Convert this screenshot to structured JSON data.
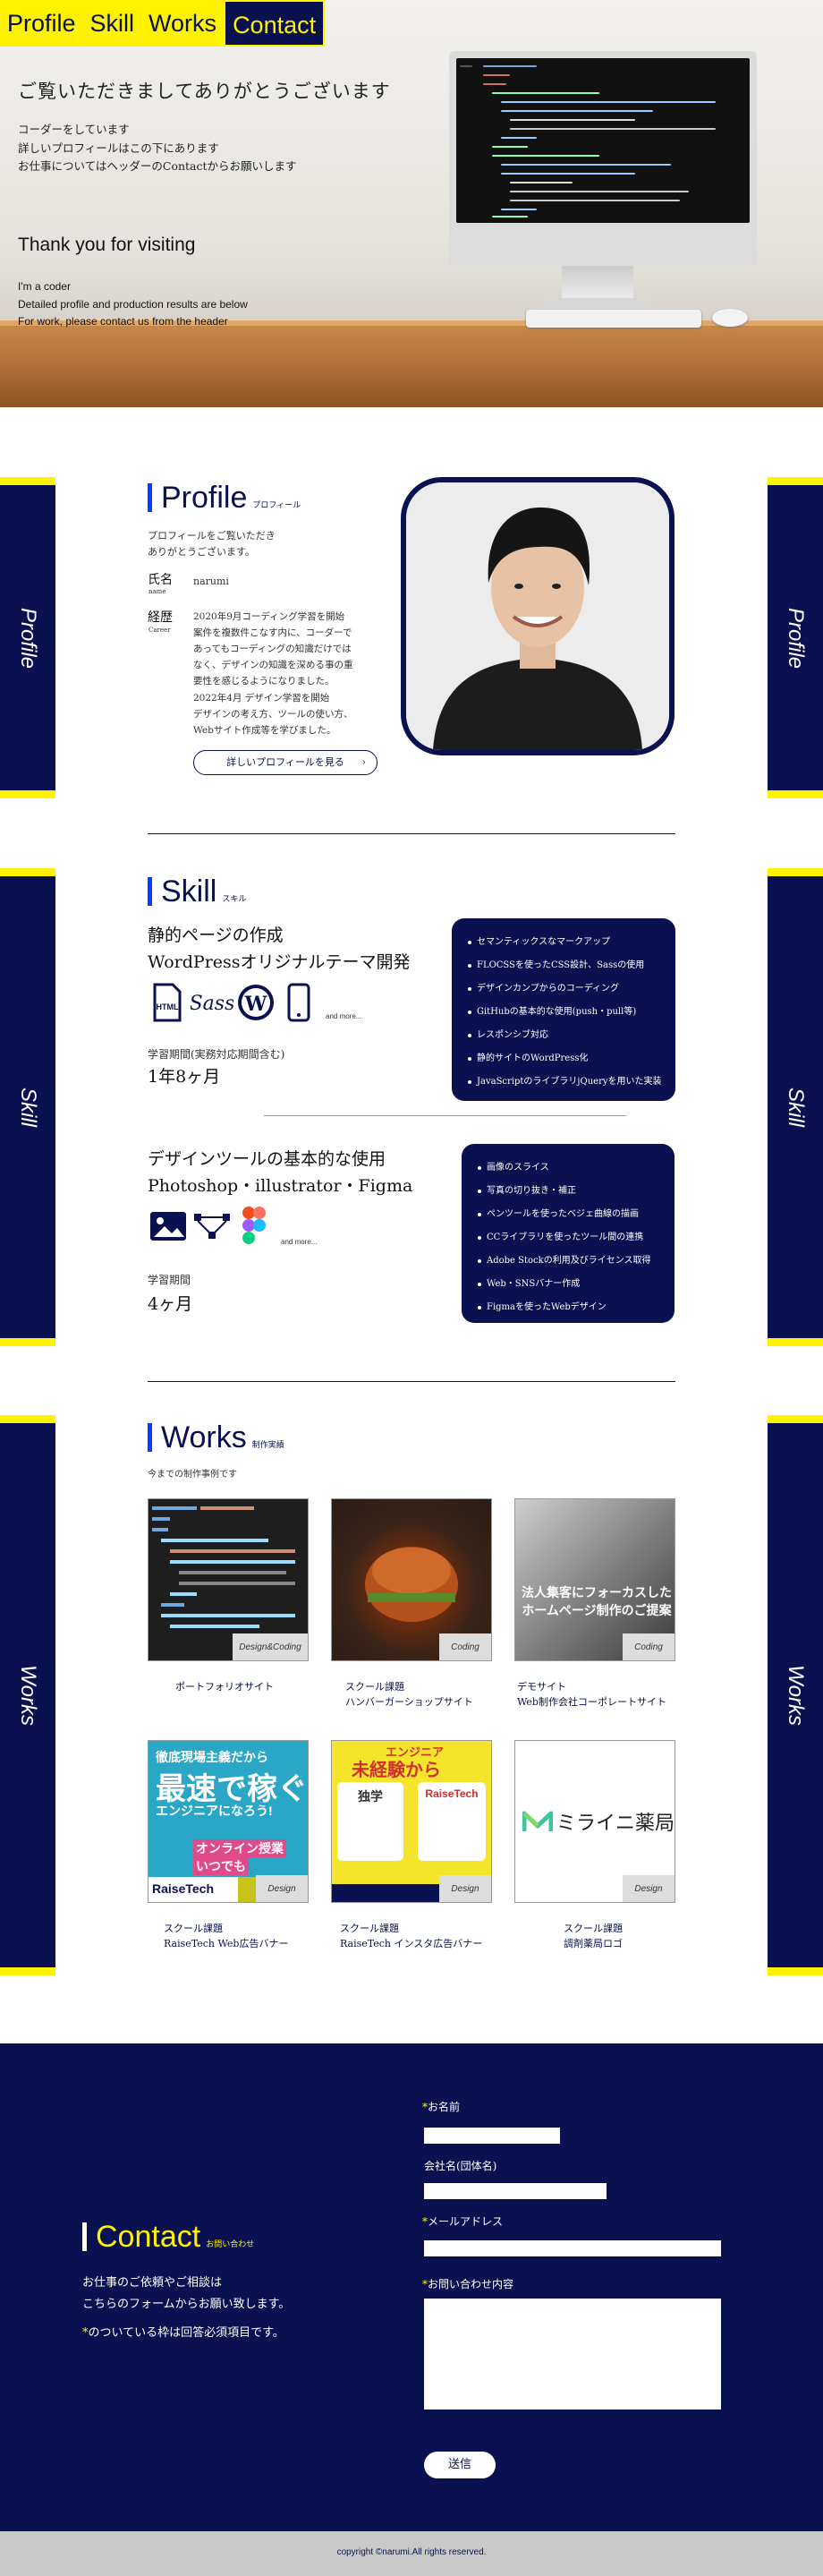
{
  "nav": {
    "items": [
      "Profile",
      "Skill",
      "Works",
      "Contact"
    ]
  },
  "hero": {
    "title_jp": "ご覧いただきましてありがとうございます",
    "lines_jp": [
      "コーダーをしています",
      "詳しいプロフィールはこの下にあります",
      "お仕事についてはヘッダーのContactからお願いします"
    ],
    "title_en": "Thank you for visiting",
    "lines_en": [
      "I'm a coder",
      "Detailed profile and production results are below",
      "For work, please contact us from the header"
    ]
  },
  "tabs": {
    "profile": "Profile",
    "skill": "Skill",
    "works": "Works"
  },
  "profile": {
    "title": "Profile",
    "sub": "プロフィール",
    "intro": [
      "プロフィールをご覧いただき",
      "ありがとうございます。"
    ],
    "name_label": "氏名",
    "name_sub": "name",
    "name": "narumi",
    "career_label": "経歴",
    "career_sub": "Career",
    "career1": [
      "2020年9月コーディング学習を開始",
      "案件を複数件こなす内に、コーダーで",
      "あってもコーディングの知識だけでは",
      "なく、デザインの知識を深める事の重",
      "要性を感じるようになりました。"
    ],
    "career2": [
      "2022年4月 デザイン学習を開始",
      "デザインの考え方、ツールの使い方、",
      "Webサイト作成等を学びました。"
    ],
    "button": "詳しいプロフィールを見る"
  },
  "skill": {
    "title": "Skill",
    "sub": "スキル",
    "block1": {
      "heading": [
        "静的ページの作成",
        "WordPressオリジナルテーマ開発"
      ],
      "more": "and more...",
      "period_label": "学習期間(実務対応期間含む)",
      "period": "1年8ヶ月",
      "items": [
        "セマンティックスなマークアップ",
        "FLOCSSを使ったCSS設計、Sassの使用",
        "デザインカンプからのコーディング",
        "GitHubの基本的な使用(push・pull等)",
        "レスポンシブ対応",
        "静的サイトのWordPress化",
        "JavaScriptのライブラリjQueryを用いた実装"
      ]
    },
    "block2": {
      "heading": [
        "デザインツールの基本的な使用",
        "Photoshop・illustrator・Figma"
      ],
      "more": "and more...",
      "period_label": "学習期間",
      "period": "4ヶ月",
      "items": [
        "画像のスライス",
        "写真の切り抜き・補正",
        "ペンツールを使ったベジェ曲線の描画",
        "CCライブラリを使ったツール間の連携",
        "Adobe Stockの利用及びライセンス取得",
        "Web・SNSバナー作成",
        "Figmaを使ったWebデザイン"
      ]
    }
  },
  "works": {
    "title": "Works",
    "sub": "制作実績",
    "intro": "今までの制作事例です",
    "items": [
      {
        "tag": "Design&Coding",
        "caption": [
          "ポートフォリオサイト"
        ]
      },
      {
        "tag": "Coding",
        "caption": [
          "スクール課題",
          "ハンバーガーショップサイト"
        ]
      },
      {
        "tag": "Coding",
        "caption": [
          "デモサイト",
          "Web制作会社コーポレートサイト"
        ]
      },
      {
        "tag": "Design",
        "caption": [
          "スクール課題",
          "RaiseTech Web広告バナー"
        ]
      },
      {
        "tag": "Design",
        "caption": [
          "スクール課題",
          "RaiseTech インスタ広告バナー"
        ]
      },
      {
        "tag": "Design",
        "caption": [
          "スクール課題",
          "調剤薬局ロゴ"
        ]
      }
    ],
    "thumb_text": {
      "w3_lines": [
        "法人集客にフォーカスした",
        "ホームページ制作のご提案"
      ],
      "w4_top": "徹底現場主義だから",
      "w4_big": "最速で稼ぐ",
      "w4_mid": "エンジニアになろう!",
      "w4_b1": "オンライン授業",
      "w4_b2": "いつでも",
      "w4_brand": "RaiseTech",
      "w5_top": "エンジニア",
      "w5_big": "未経験から",
      "w5_a": "独学",
      "w5_brand": "RaiseTech",
      "w6_logo": "ミライニ薬局"
    }
  },
  "contact": {
    "title": "Contact",
    "sub": "お問い合わせ",
    "lines": [
      "お仕事のご依頼やご相談は",
      "こちらのフォームからお願い致します。"
    ],
    "note_mark": "*",
    "note": "のついている枠は回答必須項目です。",
    "f_name": "お名前",
    "f_company": "会社名(団体名)",
    "f_email": "メールアドレス",
    "f_body": "お問い合わせ内容",
    "submit": "送信"
  },
  "footer": {
    "text": "copyright ©narumi.All rights reserved."
  },
  "colors": {
    "navy": "#0a1150",
    "yellow": "#fff200",
    "accent": "#0a3cff"
  }
}
